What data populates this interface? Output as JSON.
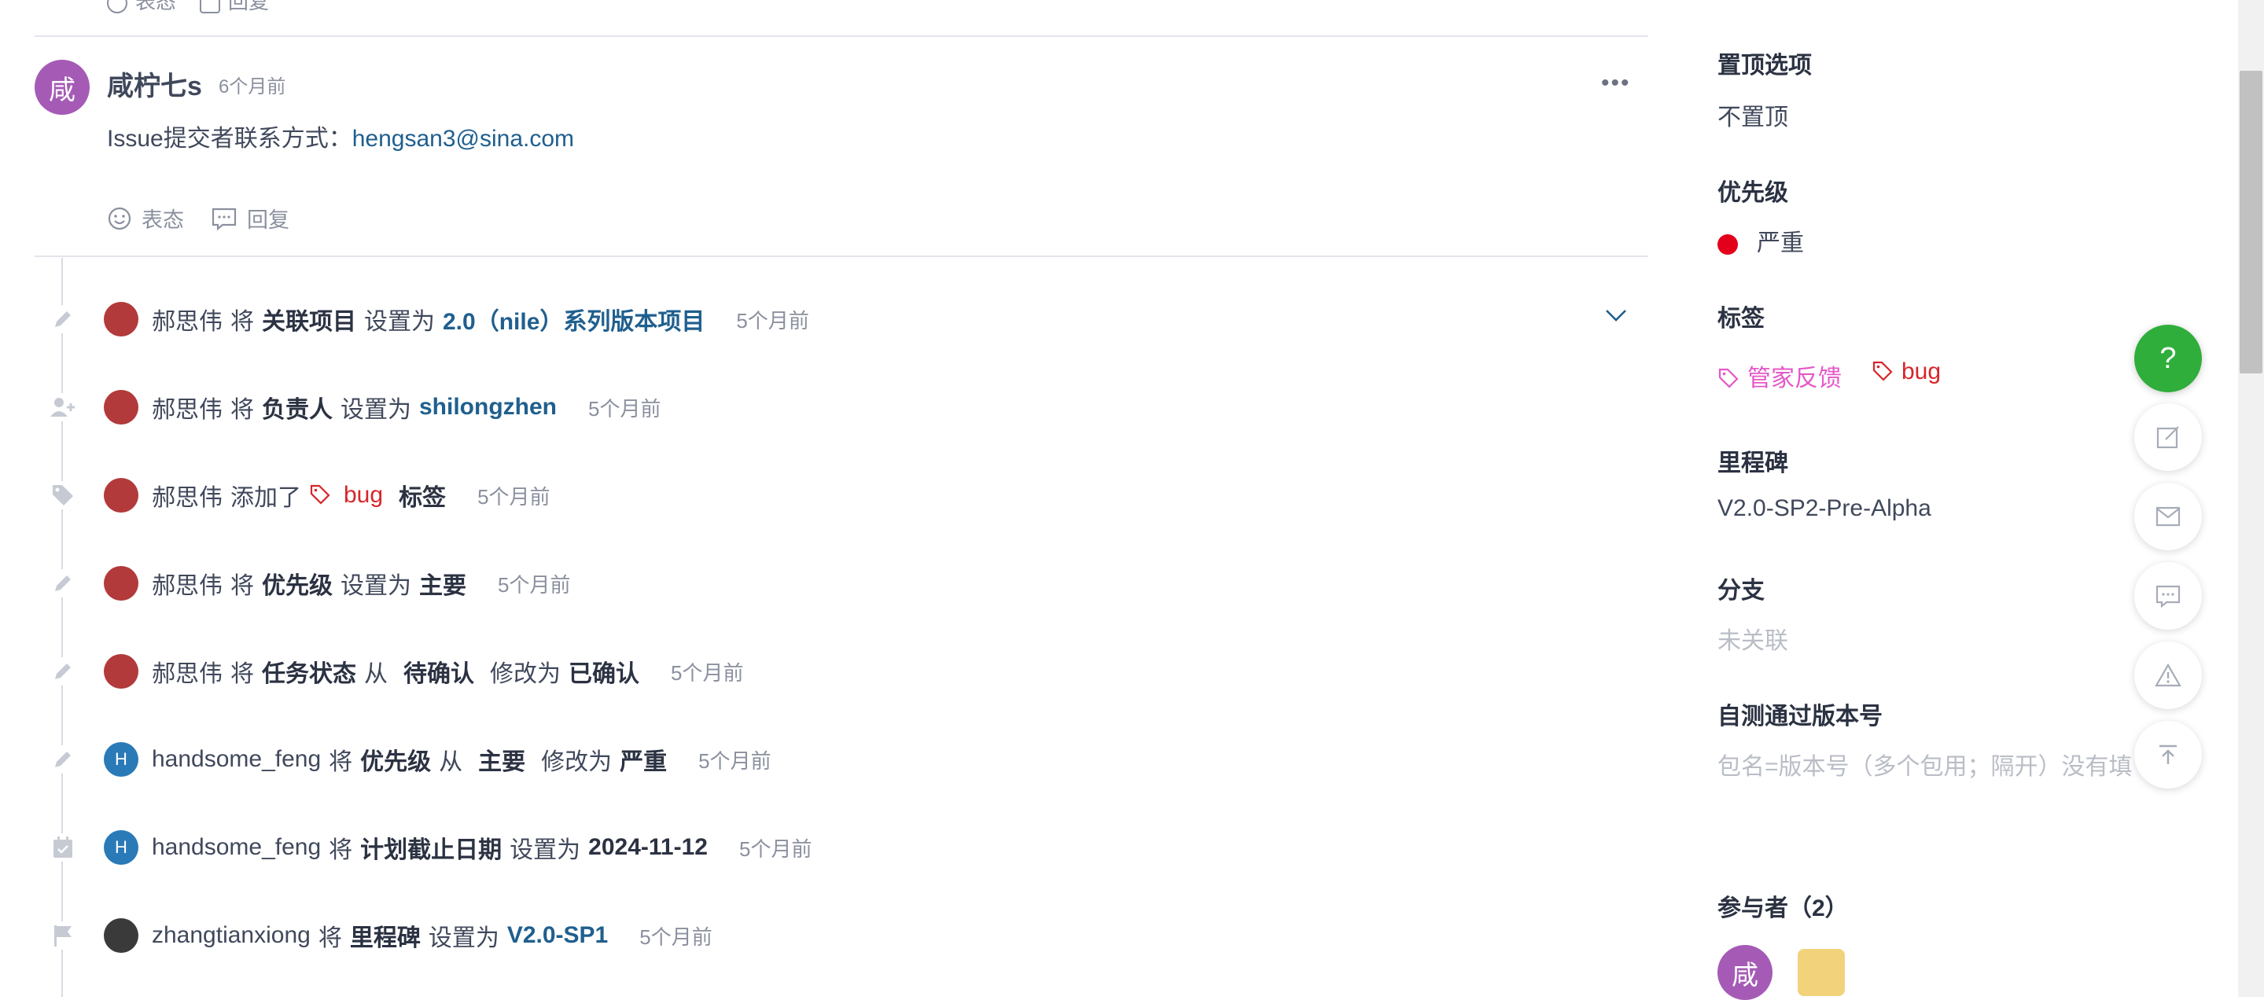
{
  "top_actions": {
    "react_label": "表态",
    "reply_label": "回复"
  },
  "comment": {
    "avatar_char": "咸",
    "author": "咸柠七s",
    "time": "6个月前",
    "body_prefix": "Issue提交者联系方式：",
    "email": "hengsan3@sina.com",
    "react_label": "表态",
    "reply_label": "回复"
  },
  "timeline": [
    {
      "icon": "pencil-icon",
      "user": "郝思伟",
      "p1": "将",
      "b1": "关联项目",
      "p2": "设置为",
      "link": "2.0（nile）系列版本项目",
      "time": "5个月前"
    },
    {
      "icon": "user-add-icon",
      "user": "郝思伟",
      "p1": "将",
      "b1": "负责人",
      "p2": "设置为",
      "link": "shilongzhen",
      "time": "5个月前"
    },
    {
      "icon": "tag-icon",
      "user": "郝思伟",
      "p1": "添加了",
      "tag": "bug",
      "b1": "标签",
      "time": "5个月前"
    },
    {
      "icon": "pencil-icon",
      "user": "郝思伟",
      "p1": "将",
      "b1": "优先级",
      "p2": "设置为",
      "b2": "主要",
      "time": "5个月前"
    },
    {
      "icon": "pencil-icon",
      "user": "郝思伟",
      "p1": "将",
      "b1": "任务状态",
      "p2": "从",
      "b2": "待确认",
      "p3": "修改为",
      "b3": "已确认",
      "time": "5个月前"
    },
    {
      "icon": "pencil-icon",
      "user": "handsome_feng",
      "avatar_char": "H",
      "p1": "将",
      "b1": "优先级",
      "p2": "从",
      "b2": "主要",
      "p3": "修改为",
      "b3": "严重",
      "time": "5个月前"
    },
    {
      "icon": "calendar-icon",
      "user": "handsome_feng",
      "avatar_char": "H",
      "p1": "将",
      "b1": "计划截止日期",
      "p2": "设置为",
      "b2": "2024-11-12",
      "time": "5个月前"
    },
    {
      "icon": "flag-icon",
      "user": "zhangtianxiong",
      "p1": "将",
      "b1": "里程碑",
      "p2": "设置为",
      "link": "V2.0-SP1",
      "time": "5个月前"
    }
  ],
  "sidebar": {
    "pin_label": "置顶选项",
    "pin_value": "不置顶",
    "priority_label": "优先级",
    "priority_value": "严重",
    "tags_label": "标签",
    "tags": [
      "管家反馈",
      "bug"
    ],
    "milestone_label": "里程碑",
    "milestone_value": "V2.0-SP2-Pre-Alpha",
    "branch_label": "分支",
    "branch_value": "未关联",
    "version_label": "自测通过版本号",
    "version_placeholder": "包名=版本号（多个包用；隔开）没有填",
    "participants_label": "参与者（2）",
    "participant_avatar_char": "咸"
  },
  "floating": {
    "help": "?"
  },
  "colors": {
    "accent_link": "#1f5f8e",
    "priority_red": "#e3001b",
    "help_green": "#2fae3b",
    "avatar_purple": "#a55bb5",
    "avatar_blue": "#2a7ab8"
  }
}
